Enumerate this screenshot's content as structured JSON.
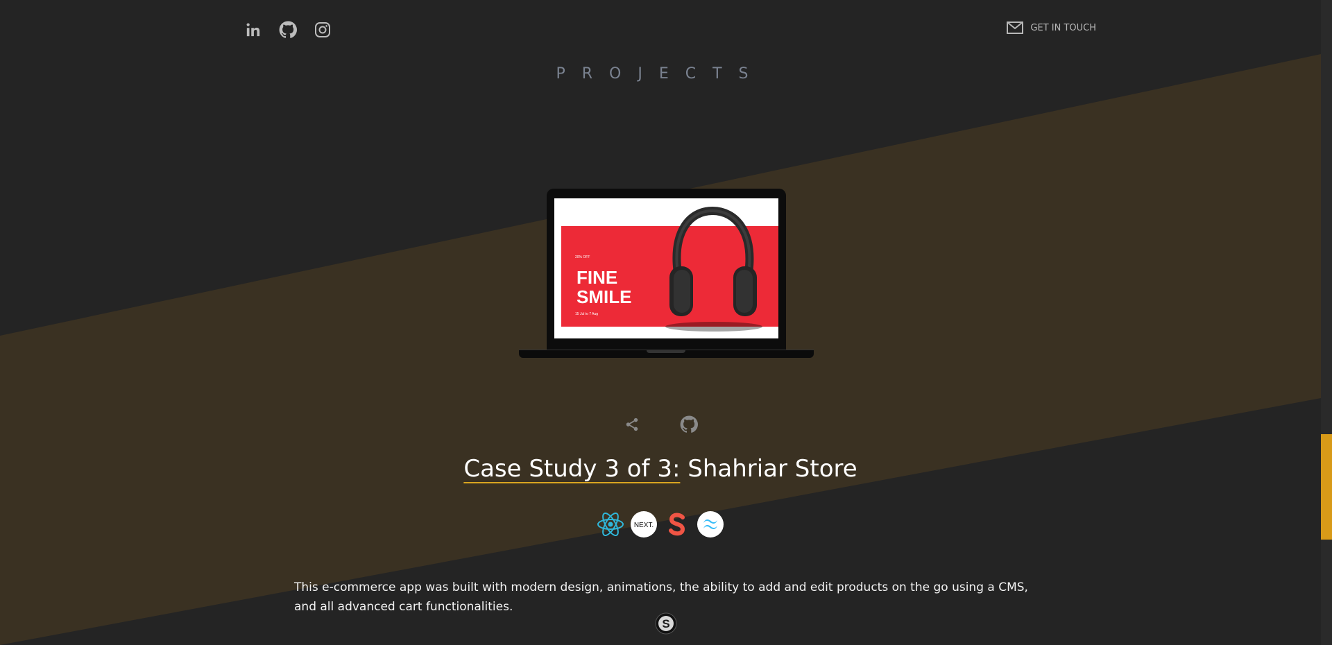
{
  "social": {
    "icons": [
      "linkedin-icon",
      "github-icon",
      "instagram-icon"
    ]
  },
  "contact": {
    "label": "GET IN TOUCH",
    "icon": "mail-icon"
  },
  "page_title": "PROJECTS",
  "project": {
    "preview": {
      "small_text": "20% OFF",
      "big_text_line1": "FINE",
      "big_text_line2": "SMILE",
      "date_text": "15 Jul to 7 Aug"
    },
    "actions": [
      "share-icon",
      "github-icon"
    ],
    "title_prefix": "Case Study 3 of 3:",
    "title_name": "Shahriar Store",
    "tech": [
      "react-icon",
      "nextjs-icon",
      "sanity-icon",
      "tailwind-icon"
    ],
    "tech_next_label": "NEXT.",
    "description": "This e-commerce app was built with modern design, animations, the ability to add and edit products on the go using a CMS, and all advanced cart functionalities.",
    "store_logo_letter": "S"
  },
  "colors": {
    "background": "#242424",
    "band": "#3a3122",
    "accent": "#d89a18",
    "muted": "#7a8290"
  }
}
